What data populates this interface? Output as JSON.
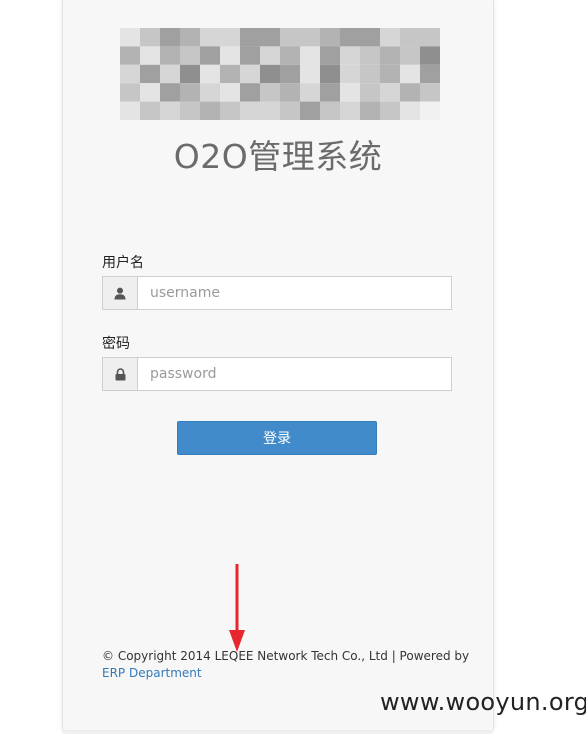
{
  "header": {
    "title": "O2O管理系统"
  },
  "form": {
    "username": {
      "label": "用户名",
      "placeholder": "username",
      "icon": "user-icon"
    },
    "password": {
      "label": "密码",
      "placeholder": "password",
      "icon": "lock-icon"
    },
    "submit_label": "登录"
  },
  "footer": {
    "copyright": "© Copyright 2014 LEQEE Network Tech Co., Ltd | Powered by ",
    "link_text": "ERP Department"
  },
  "watermark": "www.wooyun.org",
  "colors": {
    "accent": "#428bca",
    "annotation_arrow": "#e8262d"
  }
}
